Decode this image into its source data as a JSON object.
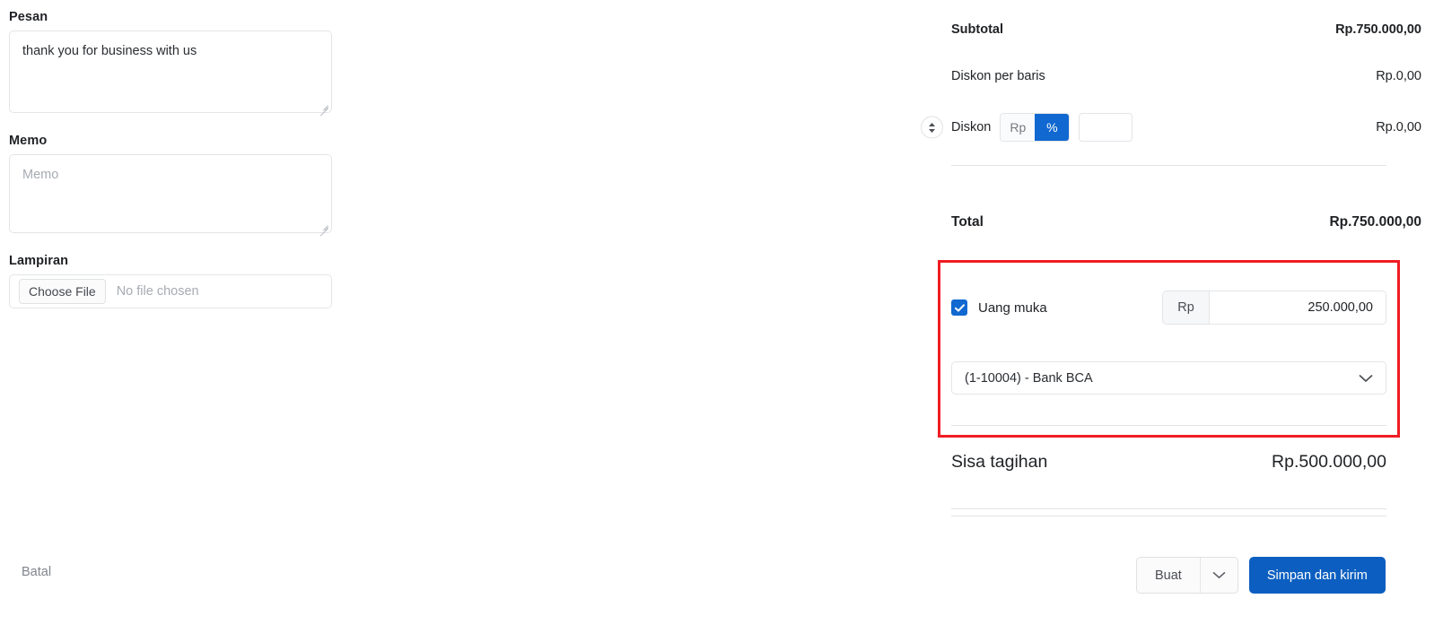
{
  "left_panel": {
    "pesan": {
      "label": "Pesan",
      "value": "thank you  for business with us"
    },
    "memo": {
      "label": "Memo",
      "value": "",
      "placeholder": "Memo"
    },
    "lampiran": {
      "label": "Lampiran",
      "choose_file_label": "Choose File",
      "file_status": "No file chosen"
    },
    "cancel_label": "Batal"
  },
  "summary": {
    "subtotal": {
      "label": "Subtotal",
      "value": "Rp.750.000,00"
    },
    "line_discount": {
      "label": "Diskon per baris",
      "value": "Rp.0,00"
    },
    "discount": {
      "label": "Diskon",
      "unit_options": [
        "Rp",
        "%"
      ],
      "selected_unit": "%",
      "amount_value": "",
      "value": "Rp.0,00"
    },
    "total": {
      "label": "Total",
      "value": "Rp.750.000,00"
    },
    "down_payment": {
      "label": "Uang muka",
      "checked": true,
      "currency_prefix": "Rp",
      "amount": "250.000,00",
      "account": "(1-10004) - Bank BCA"
    },
    "remaining": {
      "label": "Sisa tagihan",
      "value": "Rp.500.000,00"
    }
  },
  "footer": {
    "create_label": "Buat",
    "submit_label": "Simpan dan kirim"
  },
  "colors": {
    "accent_blue": "#1068d0",
    "primary_button": "#0c5fc0",
    "highlight_red": "#f01c24",
    "border": "#e3e5e8",
    "placeholder": "#a6abb2"
  }
}
